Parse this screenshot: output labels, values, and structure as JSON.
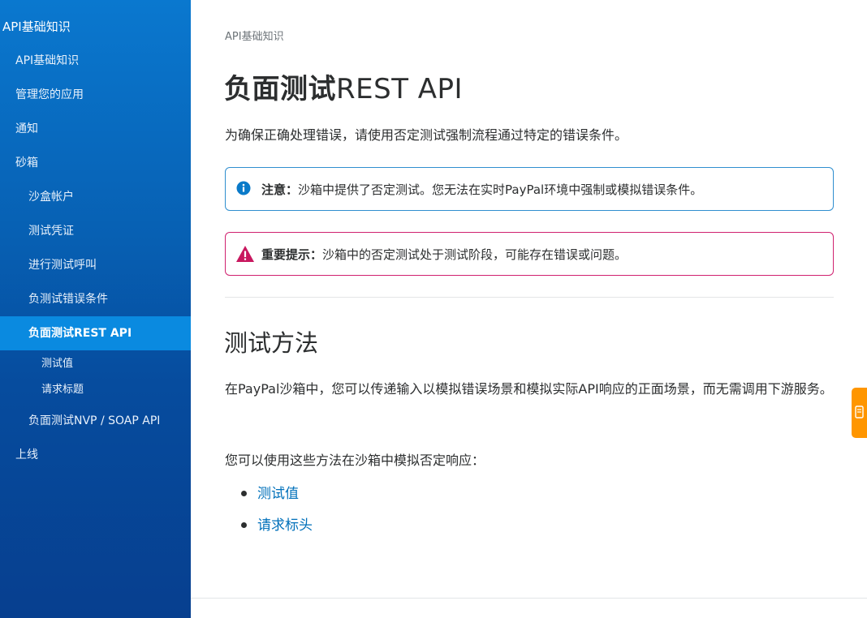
{
  "sidebar": {
    "title": "API基础知识",
    "items": [
      {
        "label": "API基础知识"
      },
      {
        "label": "管理您的应用"
      },
      {
        "label": "通知"
      },
      {
        "label": "砂箱"
      },
      {
        "label": "沙盒帐户"
      },
      {
        "label": "测试凭证"
      },
      {
        "label": "进行测试呼叫"
      },
      {
        "label": "负测试错误条件"
      },
      {
        "label": "负面测试REST API"
      },
      {
        "label": "测试值"
      },
      {
        "label": "请求标题"
      },
      {
        "label": "负面测试NVP / SOAP API"
      },
      {
        "label": "上线"
      }
    ]
  },
  "main": {
    "breadcrumb": "API基础知识",
    "title_bold": "负面测试",
    "title_rest": "REST API",
    "intro": "为确保正确处理错误，请使用否定测试强制流程通过特定的错误条件。",
    "note": {
      "label": "注意：",
      "text": "沙箱中提供了否定测试。您无法在实时PayPal环境中强制或模拟错误条件。",
      "icon": "info-icon",
      "color": "#2f8ecf"
    },
    "important": {
      "label": "重要提示：",
      "text": "沙箱中的否定测试处于测试阶段，可能存在错误或问题。",
      "icon": "warning-icon",
      "color": "#d0216f"
    },
    "section_title": "测试方法",
    "paragraph1": "在PayPal沙箱中，您可以传递输入以模拟错误场景和模拟实际API响应的正面场景，而无需调用下游服务。",
    "paragraph2": "您可以使用这些方法在沙箱中模拟否定响应：",
    "links": [
      {
        "label": "测试值"
      },
      {
        "label": "请求标头"
      }
    ]
  },
  "colors": {
    "sidebar_top": "#0a78cf",
    "sidebar_bottom": "#073f8f",
    "active_item": "#0a8ae0",
    "link": "#0070ba",
    "feedback_tab": "#ff9600"
  }
}
